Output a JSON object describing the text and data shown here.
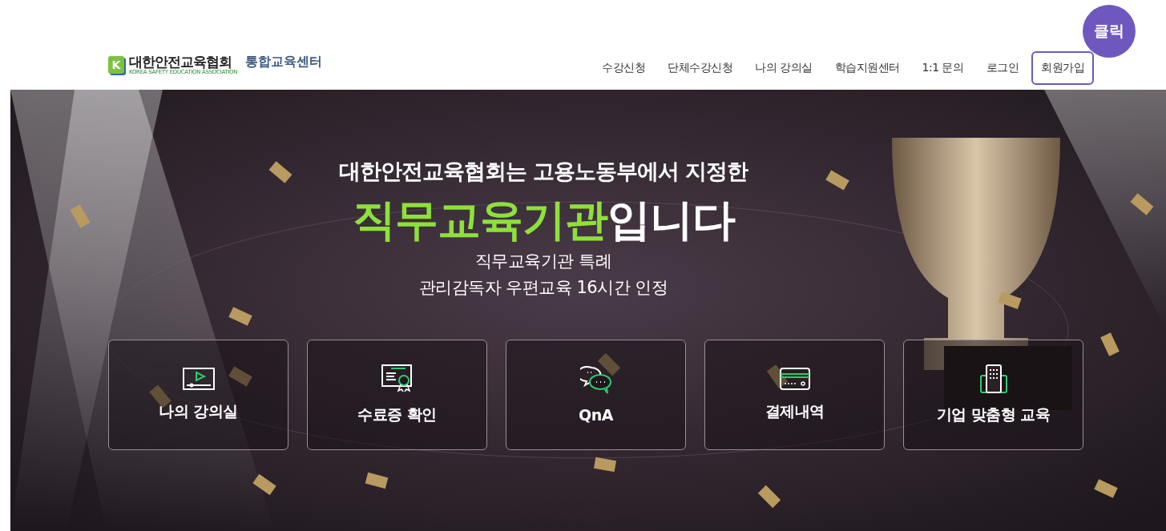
{
  "header": {
    "logo": {
      "mark": "K",
      "name": "대한안전교육협회",
      "subtitle": "KOREA SAFETY EDUCATION ASSOCIATION",
      "center": "통합교육센터"
    },
    "nav": [
      {
        "label": "수강신청",
        "highlighted": false
      },
      {
        "label": "단체수강신청",
        "highlighted": false
      },
      {
        "label": "나의 강의실",
        "highlighted": false
      },
      {
        "label": "학습지원센터",
        "highlighted": false
      },
      {
        "label": "1:1 문의",
        "highlighted": false
      },
      {
        "label": "로그인",
        "highlighted": false
      },
      {
        "label": "회원가입",
        "highlighted": true
      }
    ],
    "badge": "클릭"
  },
  "hero": {
    "kind": "picture",
    "headline": "대한안전교육협회는 고용노동부에서 지정한",
    "title_highlight": "직무교육기관",
    "title_rest": "입니다",
    "lines": [
      "직무교육기관 특례",
      "관리감독자 우편교육 16시간 인정"
    ],
    "cards": [
      {
        "label": "나의 강의실"
      },
      {
        "label": "수료증 확인"
      },
      {
        "label": "QnA"
      },
      {
        "label": "결제내역"
      },
      {
        "label": "기업 맞춤형 교육"
      }
    ]
  }
}
